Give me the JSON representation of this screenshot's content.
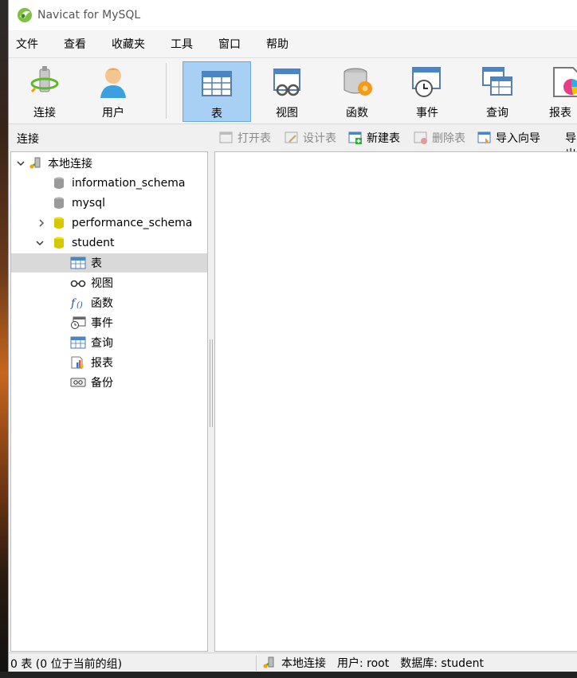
{
  "window": {
    "title": "Navicat for MySQL"
  },
  "menu": [
    "文件",
    "查看",
    "收藏夹",
    "工具",
    "窗口",
    "帮助"
  ],
  "toolbar": [
    {
      "label": "连接",
      "icon": "connection-icon"
    },
    {
      "label": "用户",
      "icon": "user-icon"
    },
    {
      "label": "表",
      "icon": "table-icon",
      "active": true
    },
    {
      "label": "视图",
      "icon": "view-icon"
    },
    {
      "label": "函数",
      "icon": "function-icon"
    },
    {
      "label": "事件",
      "icon": "event-icon"
    },
    {
      "label": "查询",
      "icon": "query-icon"
    },
    {
      "label": "报表",
      "icon": "report-icon"
    }
  ],
  "objbar": {
    "connection_label": "连接",
    "buttons": [
      {
        "label": "打开表",
        "enabled": false
      },
      {
        "label": "设计表",
        "enabled": false
      },
      {
        "label": "新建表",
        "enabled": true
      },
      {
        "label": "删除表",
        "enabled": false
      },
      {
        "label": "导入向导",
        "enabled": true
      },
      {
        "label": "导出向导",
        "enabled": true
      }
    ]
  },
  "tree": {
    "root": "本地连接",
    "databases": [
      "information_schema",
      "mysql",
      "performance_schema",
      "student"
    ],
    "student_children": [
      "表",
      "视图",
      "函数",
      "事件",
      "查询",
      "报表",
      "备份"
    ]
  },
  "status": {
    "left": "0 表 (0 位于当前的组)",
    "connection": "本地连接",
    "user": "用户: root",
    "database": "数据库: student"
  },
  "colors": {
    "selected_toolbar": "#a8d0f5",
    "db_active": "#d6c800",
    "db_inactive": "#9a9a9a"
  }
}
